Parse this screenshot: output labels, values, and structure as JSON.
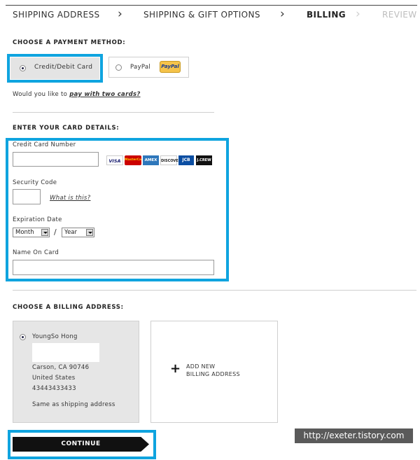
{
  "steps": {
    "items": [
      "SHIPPING ADDRESS",
      "SHIPPING & GIFT OPTIONS",
      "BILLING",
      "REVIEW"
    ],
    "chevron": "›"
  },
  "payment": {
    "heading": "CHOOSE A PAYMENT METHOD:",
    "credit_label": "Credit/Debit Card",
    "paypal_label": "PayPal",
    "paypal_logo": "PayPal",
    "two_cards_prefix": "Would you like to",
    "two_cards_link": "pay with two cards?"
  },
  "card_details": {
    "heading": "ENTER YOUR CARD DETAILS:",
    "number_label": "Credit Card Number",
    "security_label": "Security Code",
    "what_is_this": "What is this?",
    "expiration_label": "Expiration Date",
    "month_value": "Month",
    "year_value": "Year",
    "slash": "/",
    "name_label": "Name On Card",
    "card_logos": [
      "VISA",
      "MasterCard",
      "AMEX",
      "DISCOVER",
      "JCB",
      "J.CREW"
    ]
  },
  "billing": {
    "heading": "CHOOSE A BILLING ADDRESS:",
    "name": "YoungSo Hong",
    "city": "Carson, CA 90746",
    "country": "United States",
    "phone": "43443433433",
    "same_as": "Same as shipping address",
    "add_line1": "ADD NEW",
    "add_line2": "BILLING ADDRESS",
    "plus": "+"
  },
  "continue_label": "CONTINUE",
  "watermark": "http://exeter.tistory.com",
  "colors": {
    "highlight": "#0fa4df",
    "button": "#111111",
    "panel": "#e6e6e6"
  }
}
